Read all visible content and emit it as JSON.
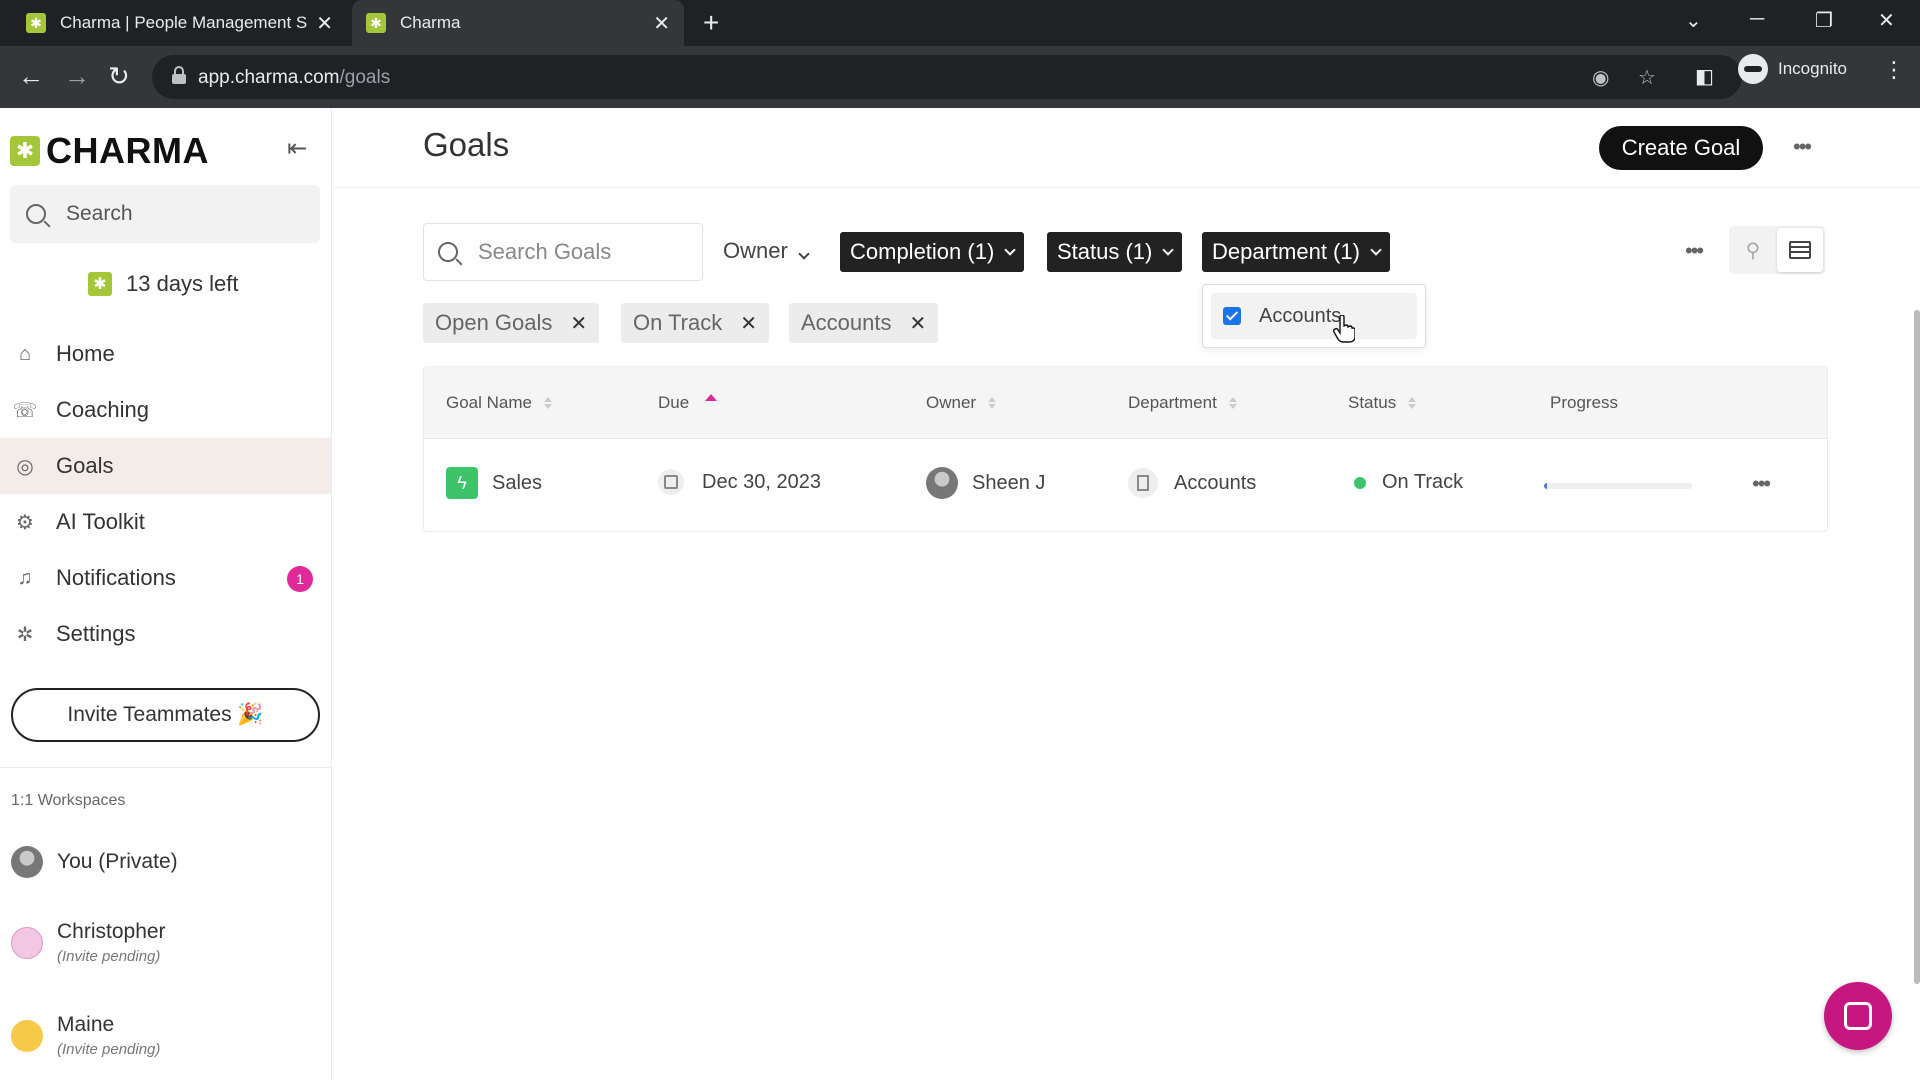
{
  "browser": {
    "tabs": [
      {
        "title": "Charma | People Management S",
        "active": false
      },
      {
        "title": "Charma",
        "active": true
      }
    ],
    "url_host": "app.charma.com",
    "url_path": "/goals",
    "profile_label": "Incognito"
  },
  "sidebar": {
    "logo_text": "CHARMA",
    "search_placeholder": "Search",
    "trial_text": "13 days left",
    "nav": [
      {
        "label": "Home",
        "icon": "home-icon",
        "active": false
      },
      {
        "label": "Coaching",
        "icon": "coaching-icon",
        "active": false
      },
      {
        "label": "Goals",
        "icon": "goals-icon",
        "active": true
      },
      {
        "label": "AI Toolkit",
        "icon": "robot-icon",
        "active": false
      },
      {
        "label": "Notifications",
        "icon": "bell-icon",
        "active": false,
        "badge": "1"
      },
      {
        "label": "Settings",
        "icon": "gear-icon",
        "active": false
      }
    ],
    "invite_label": "Invite Teammates 🎉",
    "workspaces_heading": "1:1 Workspaces",
    "workspaces": [
      {
        "name": "You (Private)",
        "sub": ""
      },
      {
        "name": "Christopher",
        "sub": "(Invite pending)"
      },
      {
        "name": "Maine",
        "sub": "(Invite pending)"
      }
    ]
  },
  "main": {
    "title": "Goals",
    "create_label": "Create Goal",
    "search_placeholder": "Search Goals",
    "filters": {
      "owner": "Owner",
      "completion": "Completion (1)",
      "status": "Status (1)",
      "department": "Department (1)"
    },
    "active_tags": [
      "Open Goals",
      "On Track",
      "Accounts"
    ],
    "department_dropdown": {
      "options": [
        {
          "label": "Accounts",
          "checked": true
        }
      ]
    },
    "table": {
      "columns": [
        "Goal Name",
        "Due",
        "Owner",
        "Department",
        "Status",
        "Progress"
      ],
      "rows": [
        {
          "goal": "Sales",
          "due": "Dec 30, 2023",
          "owner": "Sheen J",
          "department": "Accounts",
          "status": "On Track",
          "progress": 0.02
        }
      ]
    }
  },
  "colors": {
    "brand_green": "#a4c639",
    "accent_pink": "#e02a9a",
    "status_green": "#3dc46a",
    "chat_button": "#c5177f"
  }
}
